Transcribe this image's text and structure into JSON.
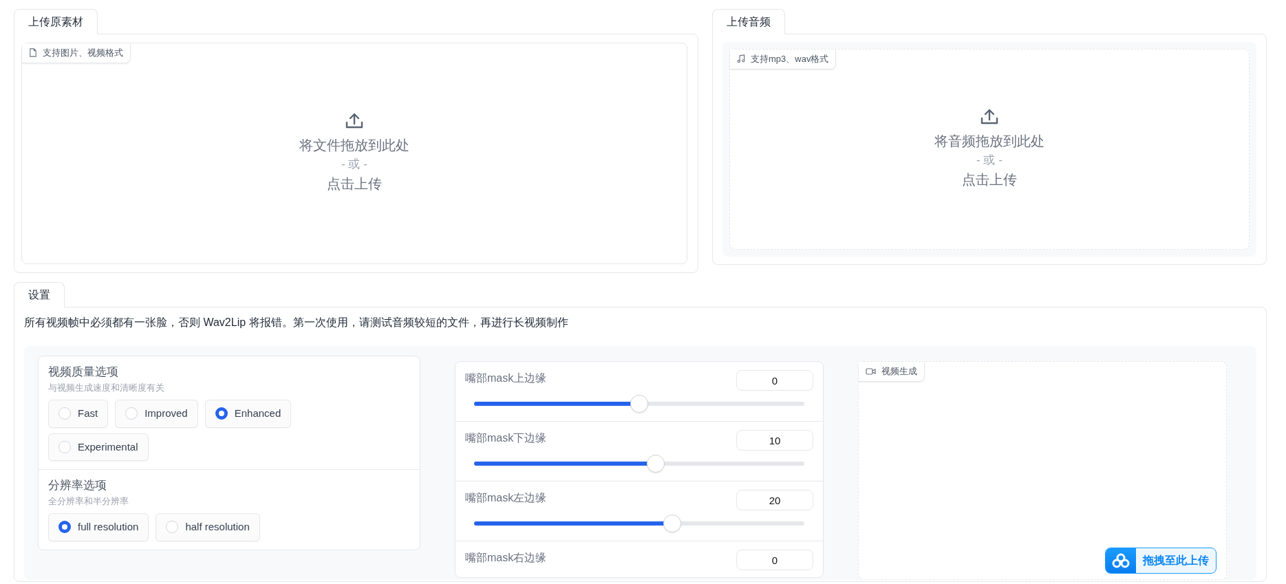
{
  "upload_media": {
    "tab": "上传原素材",
    "badge": "支持图片、视频格式",
    "drop_text": "将文件拖放到此处",
    "or_text": "- 或 -",
    "click_text": "点击上传"
  },
  "upload_audio": {
    "tab": "上传音频",
    "badge": "支持mp3、wav格式",
    "drop_text": "将音频拖放到此处",
    "or_text": "- 或 -",
    "click_text": "点击上传"
  },
  "settings": {
    "tab": "设置",
    "notice": "所有视频帧中必须都有一张脸，否则 Wav2Lip 将报错。第一次使用，请测试音频较短的文件，再进行长视频制作",
    "option_groups": [
      {
        "title": "视频质量选项",
        "hint": "与视频生成速度和清晰度有关",
        "options": [
          {
            "label": "Fast",
            "selected": false
          },
          {
            "label": "Improved",
            "selected": false
          },
          {
            "label": "Enhanced",
            "selected": true
          },
          {
            "label": "Experimental",
            "selected": false
          }
        ]
      },
      {
        "title": "分辨率选项",
        "hint": "全分辨率和半分辨率",
        "options": [
          {
            "label": "full resolution",
            "selected": true
          },
          {
            "label": "half resolution",
            "selected": false
          }
        ]
      }
    ],
    "sliders": [
      {
        "label": "嘴部mask上边缘",
        "value": "0",
        "level": 0.5
      },
      {
        "label": "嘴部mask下边缘",
        "value": "10",
        "level": 0.55
      },
      {
        "label": "嘴部mask左边缘",
        "value": "20",
        "level": 0.6
      },
      {
        "label": "嘴部mask右边缘",
        "value": "0"
      }
    ],
    "output": {
      "badge": "视频生成",
      "upload_button": "拖拽至此上传"
    }
  }
}
